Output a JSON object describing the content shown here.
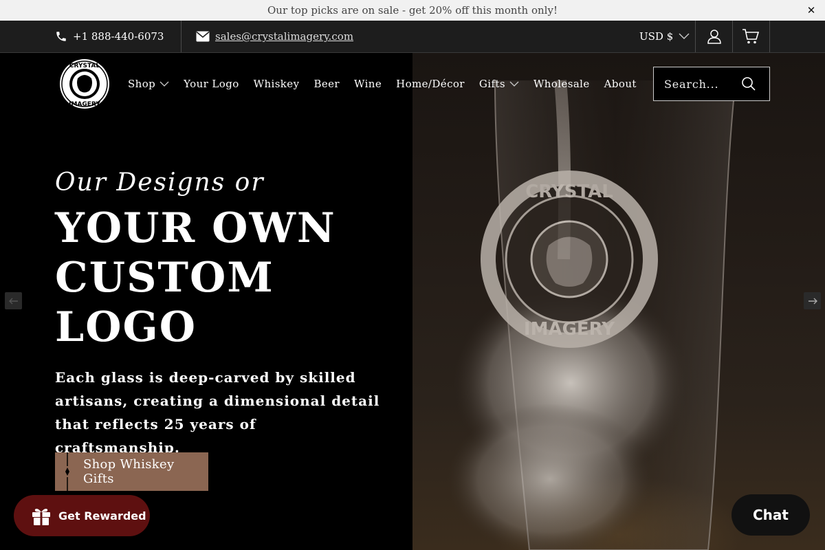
{
  "announcement": {
    "text": "Our top picks are on sale - get 20% off this month only!",
    "close_icon": "close-icon"
  },
  "utility": {
    "phone": "+1 888-440-6073",
    "email": "sales@crystalimagery.com",
    "currency": "USD $"
  },
  "nav": {
    "items": [
      {
        "label": "Shop",
        "dropdown": true
      },
      {
        "label": "Your Logo",
        "dropdown": false
      },
      {
        "label": "Whiskey",
        "dropdown": false
      },
      {
        "label": "Beer",
        "dropdown": false
      },
      {
        "label": "Wine",
        "dropdown": false
      },
      {
        "label": "Home/Décor",
        "dropdown": false
      },
      {
        "label": "Gifts",
        "dropdown": true
      },
      {
        "label": "Wholesale",
        "dropdown": false
      },
      {
        "label": "About",
        "dropdown": false
      }
    ],
    "search_placeholder": "Search..."
  },
  "logo": {
    "top": "CRYSTAL",
    "bottom": "IMAGERY"
  },
  "hero": {
    "script": "Our Designs or",
    "title": "YOUR OWN CUSTOM LOGO",
    "subtitle": "Each glass is deep-carved by skilled artisans, creating a dimensional detail that reflects 25 years of craftsmanship.",
    "cta": "Shop Whiskey Gifts",
    "glass_logo_top": "CRYSTAL",
    "glass_logo_bottom": "IMAGERY"
  },
  "rewards": {
    "label": "Get Rewarded"
  },
  "chat": {
    "label": "Chat"
  },
  "colors": {
    "announcement_bg": "#f1f1f1",
    "utility_bg": "#1d1d1d",
    "cta_bg": "#8b6652",
    "rewards_bg": "#5e1010",
    "chat_bg": "#111111"
  }
}
